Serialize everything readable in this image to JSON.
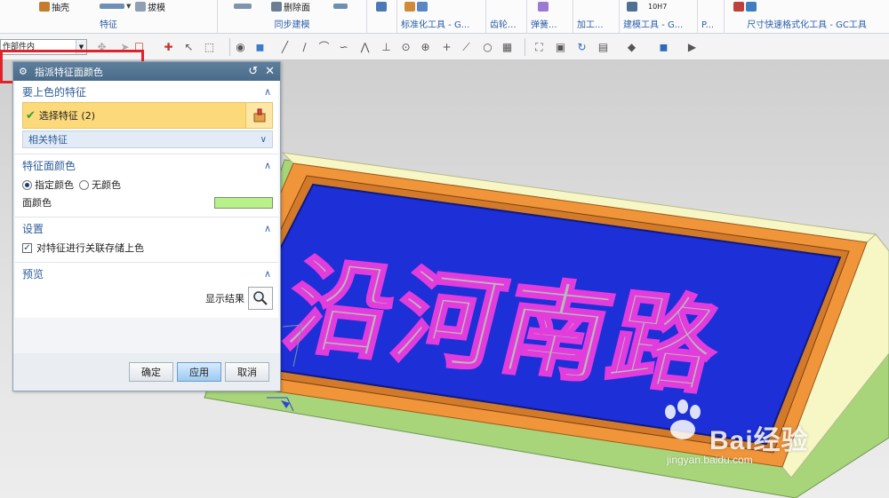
{
  "ribbon": {
    "groups": [
      {
        "name": "特征",
        "btn1": "抽壳",
        "btn2": "拔模"
      },
      {
        "name": "同步建模",
        "btn1": "删除面"
      },
      {
        "name": "标准化工具 - G...",
        "btn1": "齿轮..."
      },
      {
        "name": "弹簧...",
        "btn1": "加工..."
      },
      {
        "name": "建模工具 - G...",
        "btn1": "P..."
      },
      {
        "name": "尺寸快速格式化工具 - GC工具"
      }
    ],
    "misc_label": "10H7"
  },
  "toolbar2": {
    "filter_value": "作部件内"
  },
  "dialog": {
    "title": "指派特征面颜色",
    "sections": {
      "features": {
        "header": "要上色的特征",
        "select_label": "选择特征 (2)",
        "related_label": "相关特征"
      },
      "color": {
        "header": "特征面颜色",
        "option_specify": "指定颜色",
        "option_none": "无颜色",
        "face_color_label": "面颜色",
        "face_color_value": "#b8f08a"
      },
      "settings": {
        "header": "设置",
        "checkbox_label": "对特征进行关联存储上色"
      },
      "preview": {
        "header": "预览",
        "show_result_label": "显示结果"
      }
    },
    "buttons": {
      "ok": "确定",
      "apply": "应用",
      "cancel": "取消"
    }
  },
  "model": {
    "text": "沿河南路"
  },
  "colors": {
    "plate_blue": "#1d2fd6",
    "text_fill": "#b9b9b9",
    "text_outline": "#e33cdd",
    "frame_orange": "#f0953a",
    "base_green": "#a8d47a",
    "top_yellow": "#f6f7c5"
  },
  "watermark": {
    "brand": "Bai经验",
    "url": "jingyan.baidu.com"
  }
}
